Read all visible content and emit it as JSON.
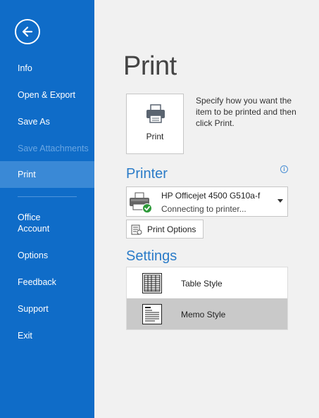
{
  "sidebar": {
    "back_icon": "back-arrow-icon",
    "items": [
      {
        "label": "Info",
        "state": "normal"
      },
      {
        "label": "Open & Export",
        "state": "normal"
      },
      {
        "label": "Save As",
        "state": "normal"
      },
      {
        "label": "Save Attachments",
        "state": "disabled"
      },
      {
        "label": "Print",
        "state": "selected"
      },
      {
        "label": "Office\nAccount",
        "state": "normal"
      },
      {
        "label": "Options",
        "state": "normal"
      },
      {
        "label": "Feedback",
        "state": "normal"
      },
      {
        "label": "Support",
        "state": "normal"
      },
      {
        "label": "Exit",
        "state": "normal"
      }
    ],
    "colors": {
      "background": "#0f6cc8",
      "selected": "#3a89d6",
      "disabled_text": "#6aa6e2"
    }
  },
  "main": {
    "title": "Print",
    "print_button_label": "Print",
    "print_description": "Specify how you want the item to be printed and then click Print.",
    "printer_section_title": "Printer",
    "printer": {
      "name": "HP Officejet 4500 G510a-f",
      "status": "Connecting to printer...",
      "icon": "printer-ready-icon"
    },
    "print_options_label": "Print Options",
    "settings_section_title": "Settings",
    "styles": [
      {
        "label": "Table Style",
        "icon": "table-style-icon",
        "selected": false
      },
      {
        "label": "Memo Style",
        "icon": "memo-style-icon",
        "selected": true
      }
    ],
    "colors": {
      "accent": "#2a7bc8",
      "background": "#f1f1f1"
    }
  }
}
